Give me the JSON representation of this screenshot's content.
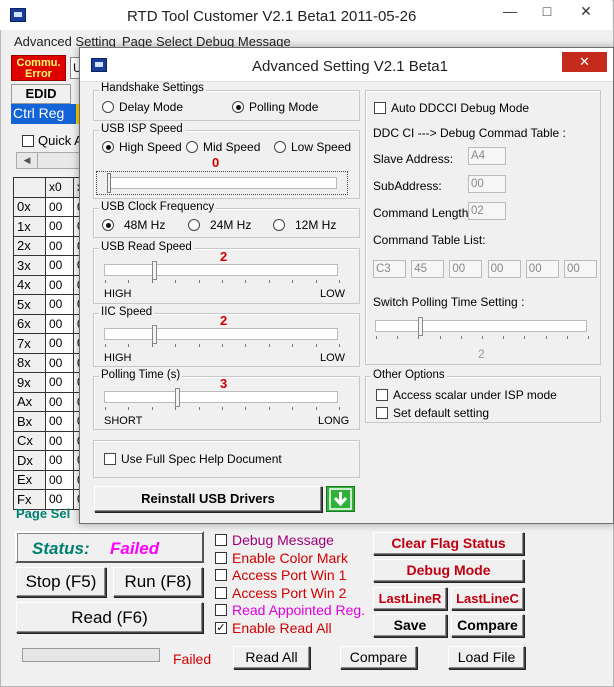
{
  "main_window": {
    "title": "RTD Tool Customer V2.1 Beta1    2011-05-26",
    "menu": [
      "Advanced Setting",
      "Page Select",
      "Debug Message"
    ],
    "commu_error": "Commu. Error",
    "field_partial": "U",
    "tabs": {
      "edid": "EDID",
      "ctrl_reg": "Ctrl Reg"
    },
    "quick_label": "Quick Ac",
    "grid": {
      "col_headers": [
        "",
        "x0",
        "x"
      ],
      "row_labels": [
        "0x",
        "1x",
        "2x",
        "3x",
        "4x",
        "5x",
        "6x",
        "7x",
        "8x",
        "9x",
        "Ax",
        "Bx",
        "Cx",
        "Dx",
        "Ex",
        "Fx"
      ],
      "cell_value": "00"
    },
    "page_select_label": "Page Sel",
    "status": {
      "label": "Status:",
      "value": "Failed"
    },
    "buttons": {
      "stop": "Stop (F5)",
      "run": "Run (F8)",
      "read": "Read (F6)",
      "clear_flag": "Clear Flag Status",
      "debug_mode": "Debug Mode",
      "last_line_r": "LastLineR",
      "last_line_c": "LastLineC",
      "save": "Save",
      "compare": "Compare",
      "read_all": "Read All",
      "compare_bottom": "Compare",
      "load_file": "Load File"
    },
    "checks": [
      {
        "label": "Debug Message",
        "checked": false,
        "color": "#a0007a"
      },
      {
        "label": "Enable Color Mark",
        "checked": false,
        "color": "#d00000"
      },
      {
        "label": "Access Port Win 1",
        "checked": false,
        "color": "#d00000"
      },
      {
        "label": "Access Port Win 2",
        "checked": false,
        "color": "#d00000"
      },
      {
        "label": "Read Appointed Reg.",
        "checked": false,
        "color": "#e000e0"
      },
      {
        "label": "Enable Read All",
        "checked": true,
        "color": "#d00000"
      }
    ],
    "bottom_status": "Failed"
  },
  "dialog": {
    "title": "Advanced Setting V2.1 Beta1",
    "handshake": {
      "legend": "Handshake Settings",
      "options": [
        "Delay Mode",
        "Polling Mode"
      ],
      "selected": "Polling Mode"
    },
    "usb_isp": {
      "legend": "USB ISP Speed",
      "options": [
        "High Speed",
        "Mid Speed",
        "Low Speed"
      ],
      "selected": "High Speed",
      "value": "0"
    },
    "usb_clock": {
      "legend": "USB Clock Frequency",
      "options": [
        "48M Hz",
        "24M Hz",
        "12M Hz"
      ],
      "selected": "48M Hz"
    },
    "usb_read": {
      "legend": "USB Read Speed",
      "value": "2",
      "min_label": "HIGH",
      "max_label": "LOW",
      "level": 0.2
    },
    "iic_speed": {
      "legend": "IIC Speed",
      "value": "2",
      "min_label": "HIGH",
      "max_label": "LOW",
      "level": 0.2
    },
    "polling_time": {
      "legend": "Polling Time (s)",
      "value": "3",
      "min_label": "SHORT",
      "max_label": "LONG",
      "level": 0.3
    },
    "use_full_spec": "Use Full Spec Help Document",
    "reinstall": "Reinstall USB Drivers",
    "auto_ddcci": "Auto DDCCI Debug Mode",
    "ddc_table_label": "DDC CI ---> Debug Commad Table :",
    "slave_address": {
      "label": "Slave Address:",
      "value": "A4"
    },
    "sub_address": {
      "label": "SubAddress:",
      "value": "00"
    },
    "command_length": {
      "label": "Command Length:",
      "value": "02"
    },
    "command_table_label": "Command Table List:",
    "command_table": [
      "C3",
      "45",
      "00",
      "00",
      "00",
      "00"
    ],
    "switch_polling": {
      "label": "Switch Polling Time Setting :",
      "value": "2",
      "level": 0.2
    },
    "other_options": {
      "legend": "Other Options",
      "items": [
        "Access scalar under ISP mode",
        "Set default setting"
      ]
    }
  }
}
